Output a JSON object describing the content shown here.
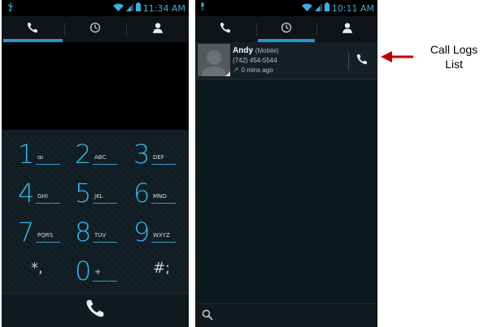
{
  "left_phone": {
    "status": {
      "time": "11:34 AM"
    },
    "tabs": [
      {
        "icon": "phone-icon",
        "active": true
      },
      {
        "icon": "clock-icon",
        "active": false
      },
      {
        "icon": "contacts-icon",
        "active": false
      }
    ],
    "dialpad": {
      "rows": [
        [
          {
            "digit": "1",
            "sub": "ꝏ"
          },
          {
            "digit": "2",
            "sub": "ABC"
          },
          {
            "digit": "3",
            "sub": "DEF"
          }
        ],
        [
          {
            "digit": "4",
            "sub": "GHI"
          },
          {
            "digit": "5",
            "sub": "JKL"
          },
          {
            "digit": "6",
            "sub": "MNO"
          }
        ],
        [
          {
            "digit": "7",
            "sub": "PQRS"
          },
          {
            "digit": "8",
            "sub": "TUV"
          },
          {
            "digit": "9",
            "sub": "WXYZ"
          }
        ]
      ],
      "bottom": {
        "star": "*,",
        "zero": "0",
        "zero_sub": "+",
        "hash": "#;"
      }
    }
  },
  "right_phone": {
    "status": {
      "time": "10:11 AM"
    },
    "tabs": [
      {
        "icon": "phone-icon",
        "active": false
      },
      {
        "icon": "clock-icon",
        "active": true
      },
      {
        "icon": "contacts-icon",
        "active": false
      }
    ],
    "call_log": [
      {
        "name": "Andy",
        "type": "(Mobile)",
        "number": "(742) 454-5544",
        "time": "0 mins ago",
        "direction": "outgoing"
      }
    ]
  },
  "annotation": {
    "label_line1": "Call Logs",
    "label_line2": "List",
    "arrow_color": "#c00000"
  },
  "colors": {
    "accent": "#1f97cf",
    "digit": "#34b6e8",
    "outgoing_arrow": "#37c44f"
  }
}
